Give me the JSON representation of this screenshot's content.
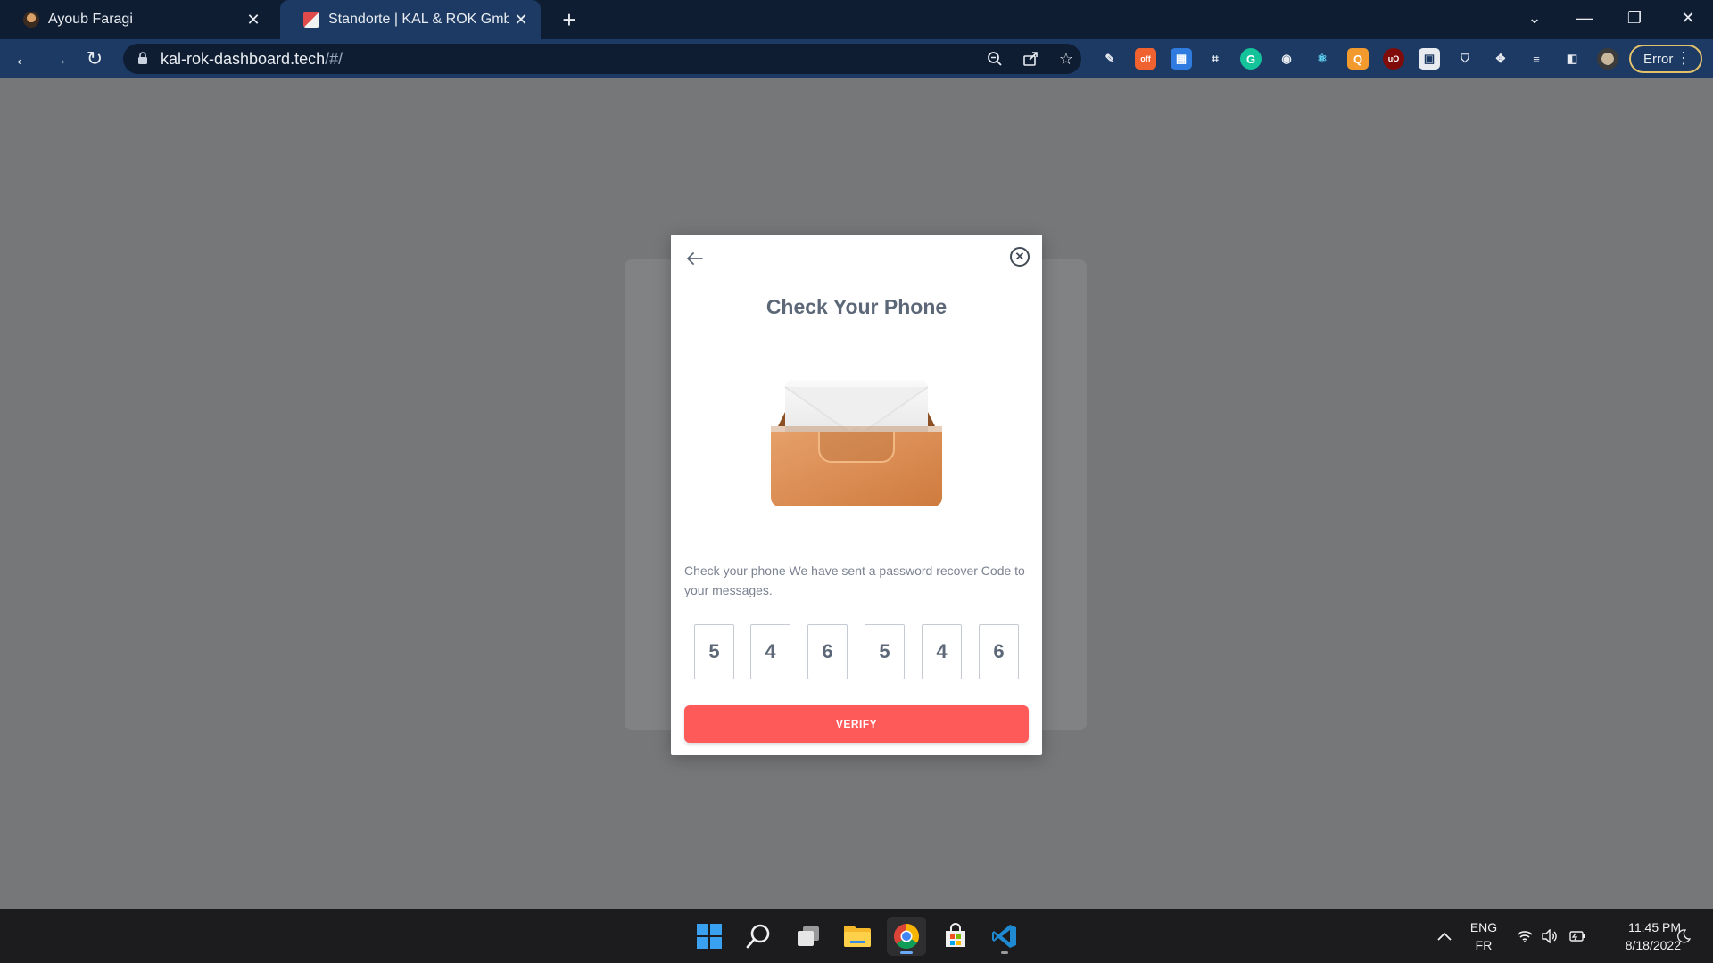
{
  "browser": {
    "tabs": [
      {
        "title": "Ayoub Faragi",
        "active": false
      },
      {
        "title": "Standorte | KAL & ROK GmbH",
        "active": true
      }
    ],
    "address": {
      "host": "kal-rok-dashboard.tech",
      "path": "/#/"
    },
    "profile_status": "Error",
    "extensions": [
      "pen-tool-icon",
      "off-badge-icon",
      "sheet-icon",
      "crop-icon",
      "grammarly-icon",
      "camera-icon",
      "react-icon",
      "orange-q-icon",
      "ublock-icon",
      "screen-icon",
      "shield-icon",
      "puzzle-icon",
      "playlist-icon",
      "sidepanel-icon"
    ],
    "colors": {
      "tabbar": "#0f1d33",
      "toolbar": "#1c3a63"
    }
  },
  "modal": {
    "title": "Check Your Phone",
    "description": "Check your phone We have sent a password recover Code to your messages.",
    "code": [
      "5",
      "4",
      "6",
      "5",
      "4",
      "6"
    ],
    "verify_label": "VERIFY",
    "accent_color": "#ff5a5a"
  },
  "taskbar": {
    "apps": [
      "windows-start-icon",
      "search-icon",
      "task-view-icon",
      "file-explorer-icon",
      "chrome-icon",
      "microsoft-store-icon",
      "vscode-icon"
    ],
    "lang_top": "ENG",
    "lang_bottom": "FR",
    "time": "11:45 PM",
    "date": "8/18/2022"
  }
}
